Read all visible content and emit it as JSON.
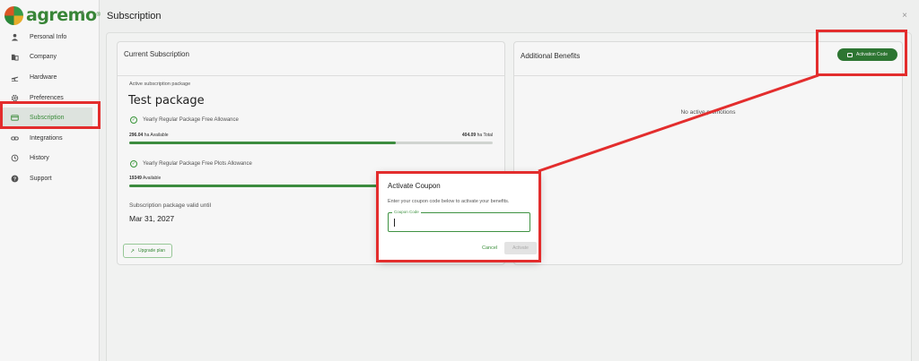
{
  "brand": {
    "name": "agremo",
    "tm": "®"
  },
  "sidebar": {
    "collapse_icon": "chevron-left-icon",
    "items": [
      {
        "label": "Personal Info",
        "icon": "person-icon"
      },
      {
        "label": "Company",
        "icon": "building-icon"
      },
      {
        "label": "Hardware",
        "icon": "plane-icon"
      },
      {
        "label": "Preferences",
        "icon": "gear-icon"
      },
      {
        "label": "Subscription",
        "icon": "card-icon",
        "active": true
      },
      {
        "label": "Integrations",
        "icon": "link-icon"
      },
      {
        "label": "History",
        "icon": "history-icon"
      },
      {
        "label": "Support",
        "icon": "help-icon"
      }
    ]
  },
  "header": {
    "title": "Subscription",
    "close": "×"
  },
  "current": {
    "title": "Current Subscription",
    "active_label": "Active subscription package",
    "package_name": "Test package",
    "allowance1": {
      "label": "Yearly Regular Package Free Allowance",
      "available": "296.04",
      "available_unit": "ha Available",
      "total": "404.09",
      "total_unit": "ha Total",
      "fill_ratio": 0.733
    },
    "allowance2": {
      "label": "Yearly Regular Package Free Plots Allowance",
      "available": "19349",
      "available_unit": "Available",
      "fill_ratio": 0.97
    },
    "valid_label": "Subscription package valid until",
    "valid_date": "Mar 31, 2027",
    "upgrade_label": "Upgrade plan"
  },
  "benefits": {
    "title": "Additional Benefits",
    "activation_button": "Activation Code",
    "empty_text": "No active promotions"
  },
  "dialog": {
    "title": "Activate Coupon",
    "description": "Enter your coupon code below to activate your benefits.",
    "field_label": "Coupon Code",
    "field_value": "",
    "cancel_label": "Cancel",
    "activate_label": "Activate"
  },
  "colors": {
    "brand_green": "#3f9242",
    "annotation_red": "#e32d2d"
  }
}
